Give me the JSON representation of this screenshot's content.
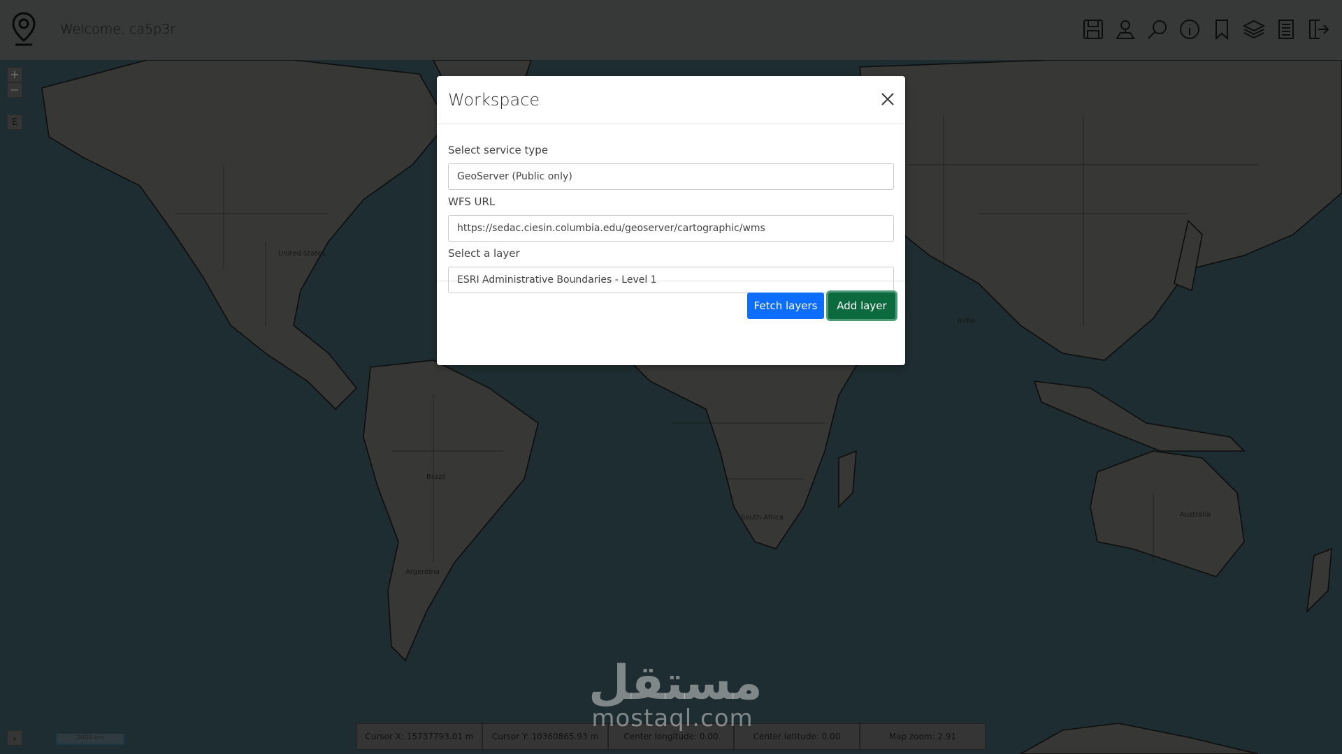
{
  "header": {
    "welcome_text": "Welcome, ca5p3r",
    "tools": [
      "save-icon",
      "map-pin-user-icon",
      "search-icon",
      "info-icon",
      "bookmark-icon",
      "layers-icon",
      "list-icon",
      "logout-icon"
    ]
  },
  "map": {
    "labels": [
      "United States",
      "Brazil",
      "Argentina",
      "Australia",
      "India",
      "South Africa"
    ],
    "zoom_in": "+",
    "zoom_out": "−",
    "extent_button": "E",
    "expand_button": "›",
    "scale_text": "2000 km"
  },
  "status_bar": {
    "cursor_x": "Cursor X: 15737793.01 m",
    "cursor_y": "Cursor Y: 10360865.93 m",
    "center_lon": "Center longitude: 0.00",
    "center_lat": "Center latitude: 0.00",
    "map_zoom": "Map zoom: 2.91"
  },
  "modal": {
    "title": "Workspace",
    "service_type_label": "Select service type",
    "service_type_value": "GeoServer (Public only)",
    "wfs_url_label": "WFS URL",
    "wfs_url_value": "https://sedac.ciesin.columbia.edu/geoserver/cartographic/wms",
    "layer_label": "Select a layer",
    "layer_value": "ESRI Administrative Boundaries - Level 1",
    "fetch_button": "Fetch layers",
    "add_button": "Add layer"
  },
  "watermark": {
    "arabic": "مستقل",
    "latin": "mostaql.com"
  },
  "colors": {
    "ocean": "#3d5a63",
    "land": "#6e6e6c",
    "header": "#6f7070",
    "fetch_button": "#0d6efd",
    "add_button": "#0b6b3e"
  }
}
